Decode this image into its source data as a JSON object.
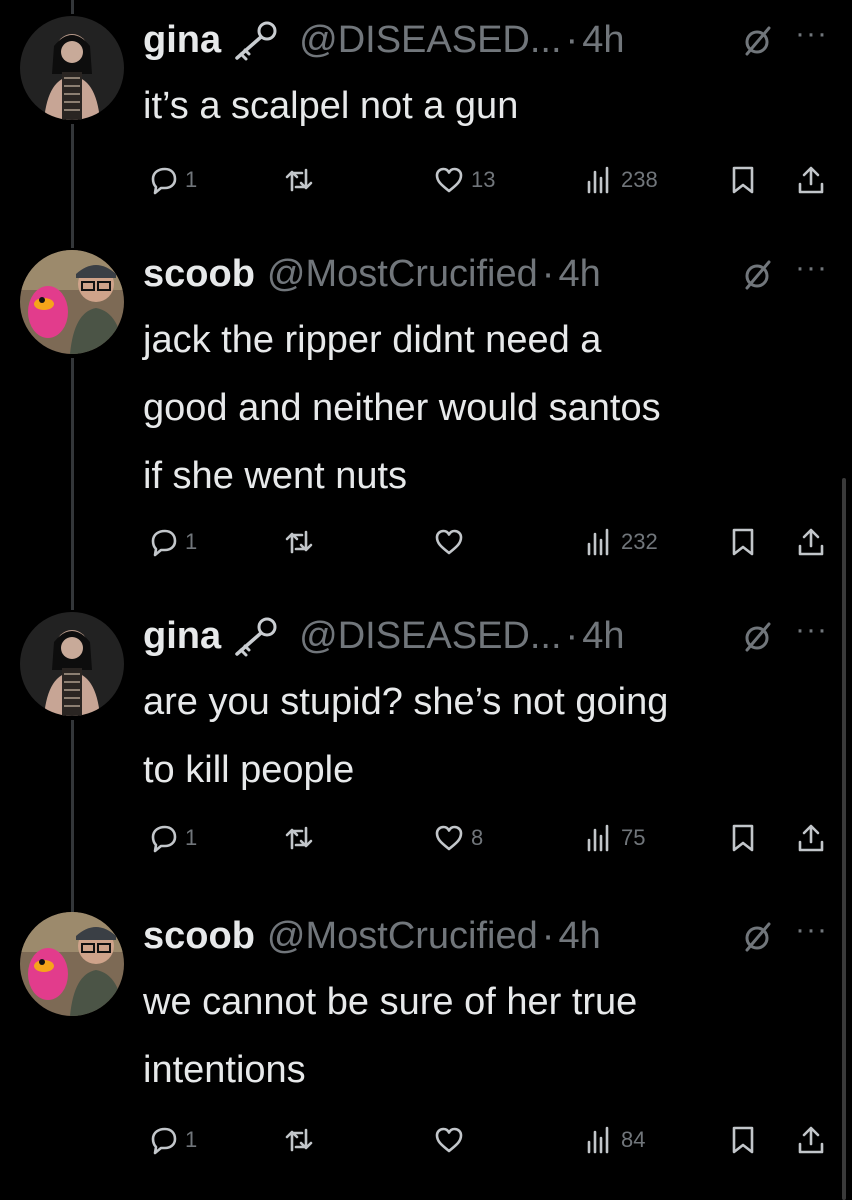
{
  "tweets": [
    {
      "name": "gina",
      "verified_key": true,
      "handle": "@DISEASED...",
      "separator": "·",
      "time": "4h",
      "lines": [
        "it’s a scalpel not a gun"
      ],
      "replies": "1",
      "retweets": "",
      "likes": "13",
      "views": "238"
    },
    {
      "name": "scoob",
      "verified_key": false,
      "handle": "@MostCrucified",
      "separator": "·",
      "time": "4h",
      "lines": [
        "jack the ripper didnt need a",
        "good and neither would santos",
        "if she went nuts"
      ],
      "replies": "1",
      "retweets": "",
      "likes": "",
      "views": "232"
    },
    {
      "name": "gina",
      "verified_key": true,
      "handle": "@DISEASED...",
      "separator": "·",
      "time": "4h",
      "lines": [
        "are you stupid? she’s not going",
        "to kill people"
      ],
      "replies": "1",
      "retweets": "",
      "likes": "8",
      "views": "75"
    },
    {
      "name": "scoob",
      "verified_key": false,
      "handle": "@MostCrucified",
      "separator": "·",
      "time": "4h",
      "lines": [
        "we cannot be sure of her true",
        "intentions"
      ],
      "replies": "1",
      "retweets": "",
      "likes": "",
      "views": "84"
    }
  ],
  "more_glyph": "···",
  "icons": [
    "key-icon",
    "grok-icon",
    "more-icon",
    "reply-icon",
    "retweet-icon",
    "like-icon",
    "views-icon",
    "bookmark-icon",
    "share-icon"
  ],
  "colors": {
    "background": "#000000",
    "text": "#e7e9ea",
    "muted": "#71767b",
    "thread_line": "#333639"
  }
}
